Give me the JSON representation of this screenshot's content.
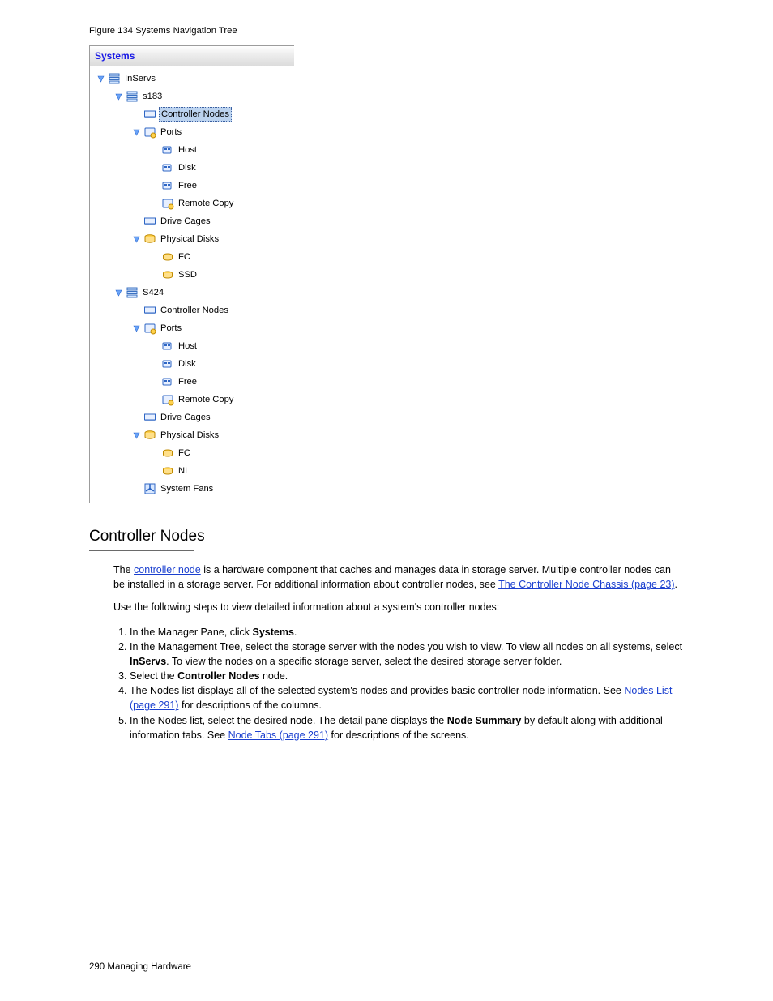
{
  "figure_caption": "Figure 134 Systems Navigation Tree",
  "panel_title": "Systems",
  "tree": {
    "root": "InServs",
    "node1": "s183",
    "n1_controller": "Controller Nodes",
    "n1_ports": "Ports",
    "n1_host": "Host",
    "n1_disk": "Disk",
    "n1_free": "Free",
    "n1_remote": "Remote Copy",
    "n1_drive": "Drive Cages",
    "n1_phys": "Physical Disks",
    "n1_fc": "FC",
    "n1_ssd": "SSD",
    "node2": "S424",
    "n2_controller": "Controller Nodes",
    "n2_ports": "Ports",
    "n2_host": "Host",
    "n2_disk": "Disk",
    "n2_free": "Free",
    "n2_remote": "Remote Copy",
    "n2_drive": "Drive Cages",
    "n2_phys": "Physical Disks",
    "n2_fc": "FC",
    "n2_nl": "NL",
    "n2_fans": "System Fans"
  },
  "section_title": "Controller Nodes",
  "para1_a": "The ",
  "link1": "controller node",
  "para1_b": " is a hardware component that caches and manages data in storage server. Multiple controller nodes can be installed in a storage server. For additional information about controller nodes, see ",
  "link2": "The Controller Node Chassis (page 23)",
  "para1_c": ".",
  "para2": "Use the following steps to view detailed information about a system's controller nodes:",
  "steps": {
    "s1a": "In the Manager Pane, click ",
    "s1b": "Systems",
    "s1c": ".",
    "s2a": "In the Management Tree, select the storage server with the nodes you wish to view. To view all nodes on all systems, select ",
    "s2b": "InServs",
    "s2c": ". To view the nodes on a specific storage server, select the desired storage server folder.",
    "s3a": "Select the ",
    "s3b": "Controller Nodes",
    "s3c": " node.",
    "s4a": "The Nodes list displays all of the selected system's nodes and provides basic controller node information. See ",
    "s4link": "Nodes List (page 291)",
    "s4b": " for descriptions of the columns.",
    "s5a": "In the Nodes list, select the desired node. The detail pane displays the ",
    "s5b": "Node Summary",
    "s5c": " by default along with additional information tabs. See ",
    "s5link": "Node Tabs (page 291)",
    "s5d": " for descriptions of the screens."
  },
  "footer_left": "290   Managing Hardware",
  "icons": {
    "server": "server-icon",
    "controller": "controller-icon",
    "ports": "ports-icon",
    "port": "port-icon",
    "drive": "drive-cage-icon",
    "disks": "disks-icon",
    "disk": "disk-icon",
    "fan": "fan-icon",
    "expand": "expand-icon",
    "none": "no-icon"
  }
}
